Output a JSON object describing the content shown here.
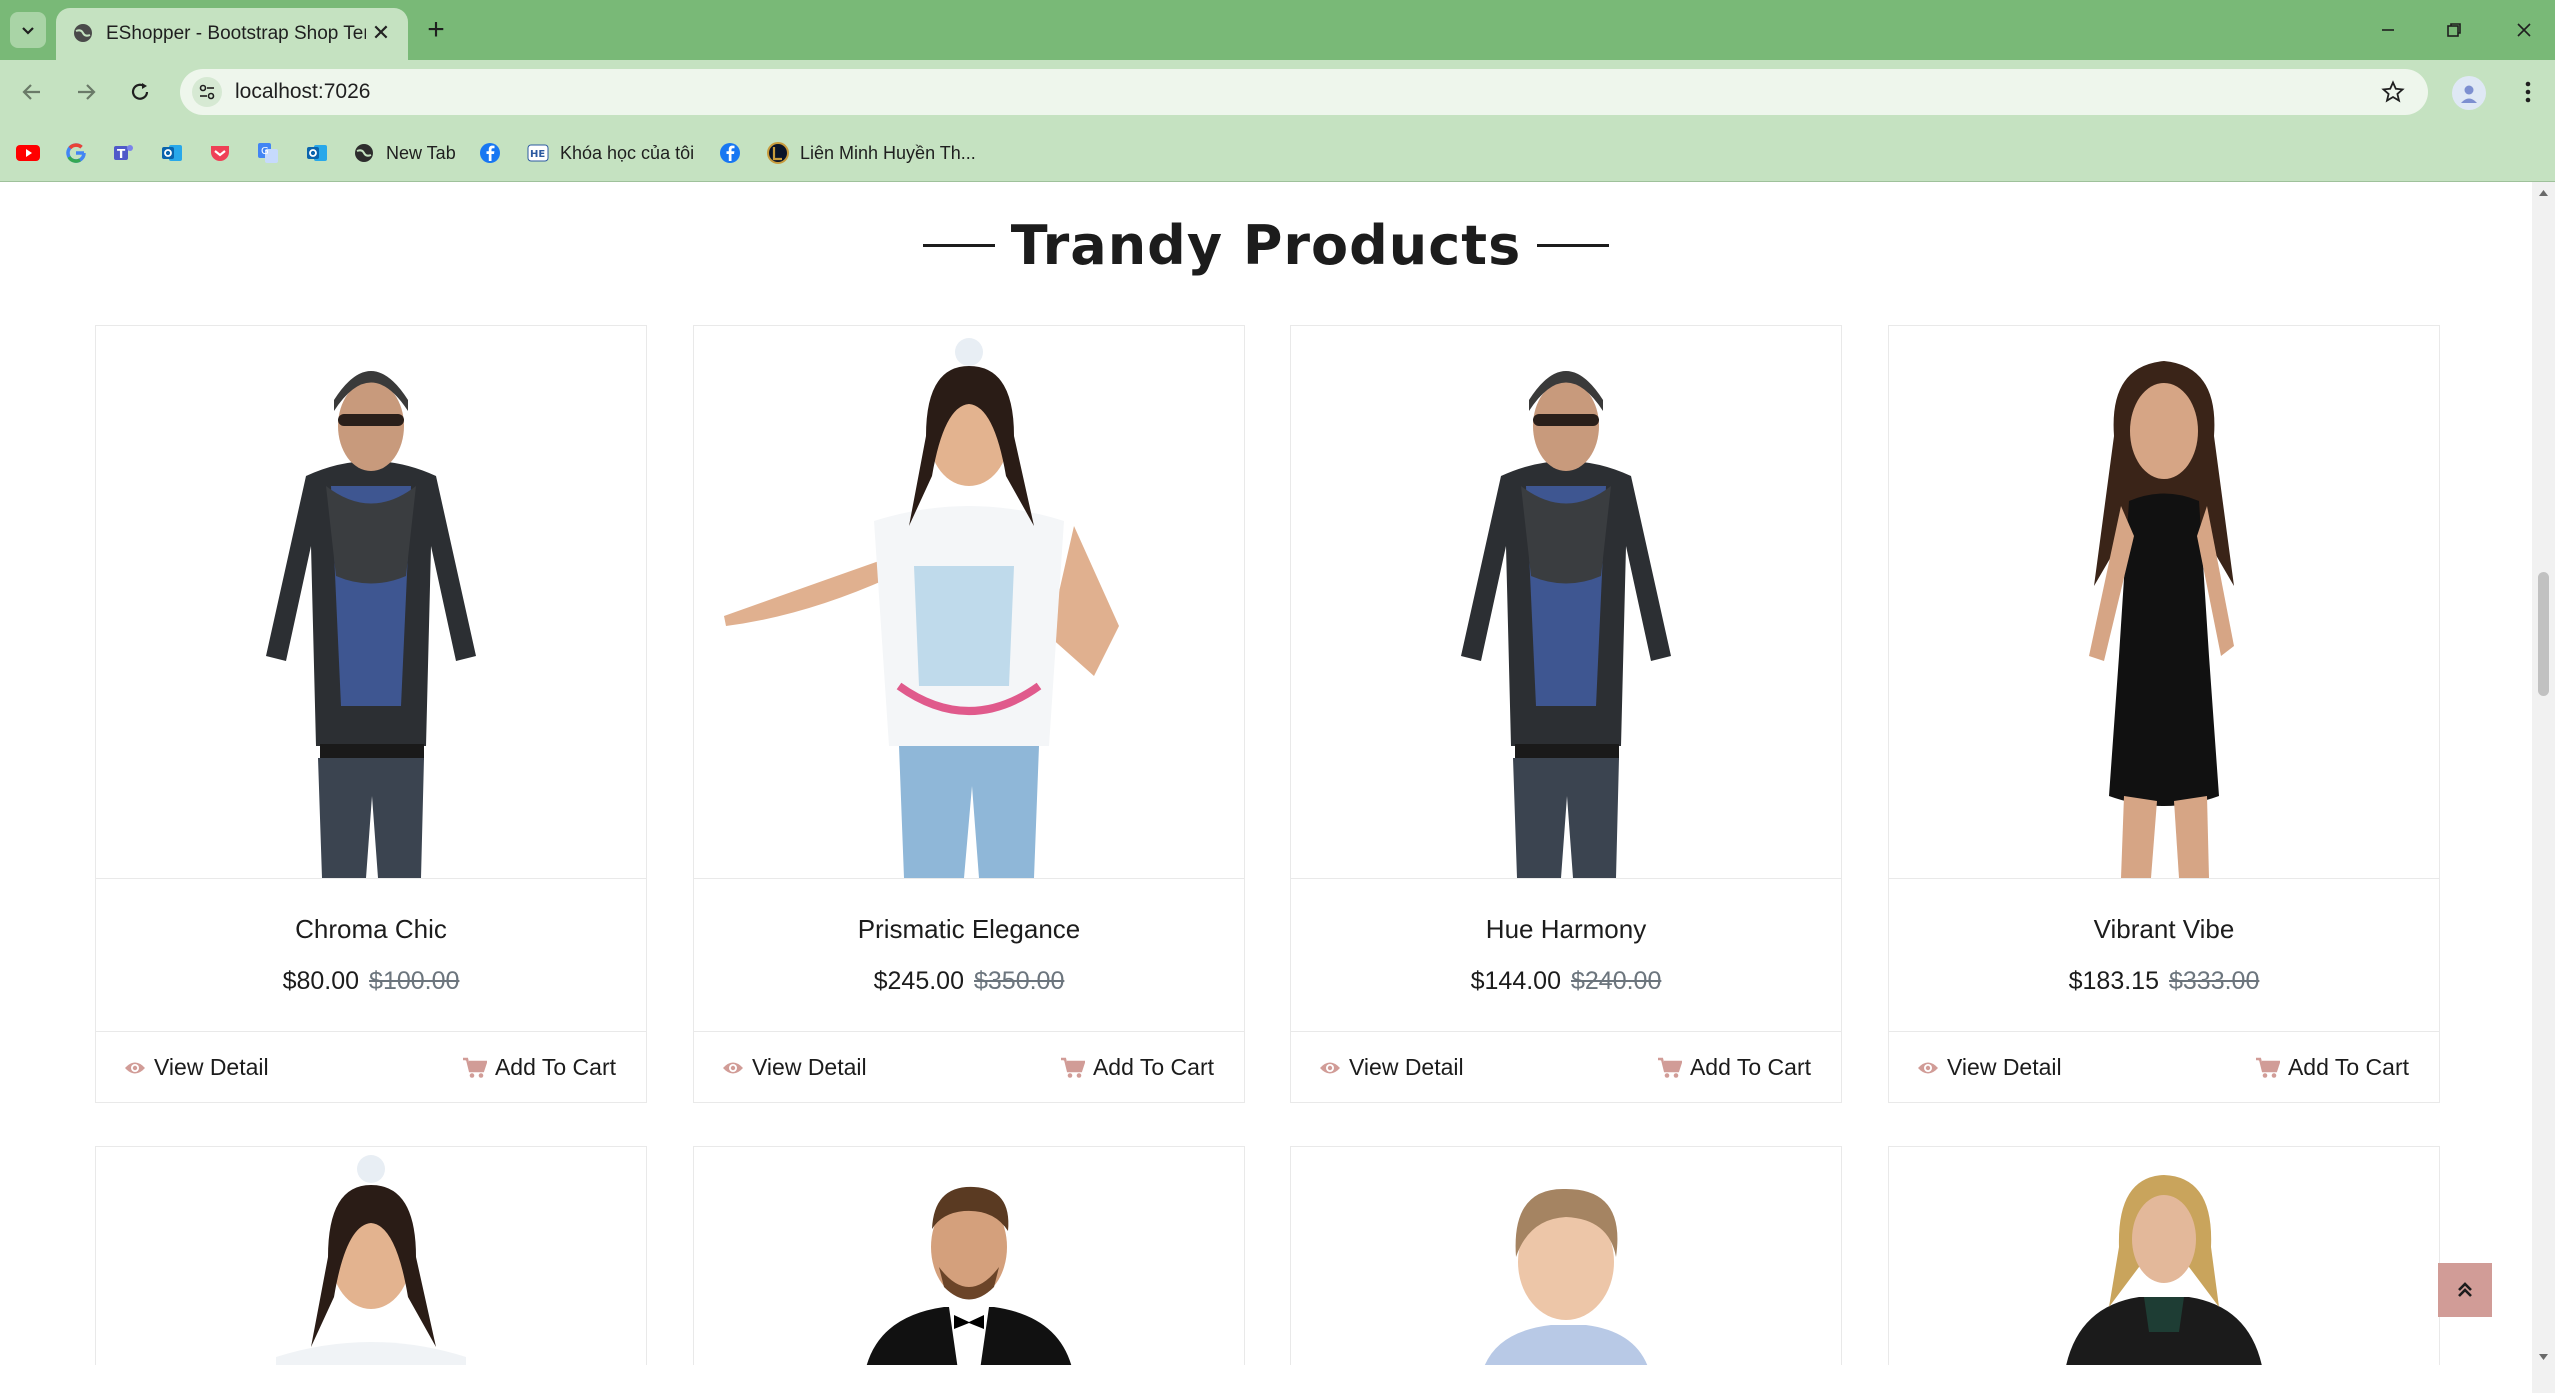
{
  "browser": {
    "tab_title": "EShopper - Bootstrap Shop Template",
    "url": "localhost:7026",
    "bookmarks": [
      {
        "icon": "youtube-icon",
        "label": ""
      },
      {
        "icon": "google-icon",
        "label": ""
      },
      {
        "icon": "teams-icon",
        "label": ""
      },
      {
        "icon": "outlook-icon",
        "label": ""
      },
      {
        "icon": "pocket-icon",
        "label": ""
      },
      {
        "icon": "translate-icon",
        "label": ""
      },
      {
        "icon": "outlook-icon",
        "label": ""
      },
      {
        "icon": "globe-icon",
        "label": "New Tab"
      },
      {
        "icon": "facebook-icon",
        "label": ""
      },
      {
        "icon": "course-icon",
        "label": "Khóa học của tôi"
      },
      {
        "icon": "facebook-icon",
        "label": ""
      },
      {
        "icon": "lol-icon",
        "label": "Liên Minh Huyền Th..."
      }
    ]
  },
  "section": {
    "title": "Trandy Products"
  },
  "products": [
    {
      "name": "Chroma Chic",
      "price": "$80.00",
      "old_price": "$100.00",
      "view_label": "View Detail",
      "cart_label": "Add To Cart",
      "image": "man-leather-jacket"
    },
    {
      "name": "Prismatic Elegance",
      "price": "$245.00",
      "old_price": "$350.00",
      "view_label": "View Detail",
      "cart_label": "Add To Cart",
      "image": "girl-white-tshirt"
    },
    {
      "name": "Hue Harmony",
      "price": "$144.00",
      "old_price": "$240.00",
      "view_label": "View Detail",
      "cart_label": "Add To Cart",
      "image": "man-leather-jacket"
    },
    {
      "name": "Vibrant Vibe",
      "price": "$183.15",
      "old_price": "$333.00",
      "view_label": "View Detail",
      "cart_label": "Add To Cart",
      "image": "woman-black-dress"
    }
  ],
  "products_row2": [
    {
      "image": "girl-white-tshirt"
    },
    {
      "image": "man-tuxedo"
    },
    {
      "image": "boy-blue-shirt"
    },
    {
      "image": "woman-black-coat"
    }
  ],
  "colors": {
    "accent": "#d19c97",
    "tabbar": "#79b977",
    "toolbar": "#c5e2c1"
  }
}
